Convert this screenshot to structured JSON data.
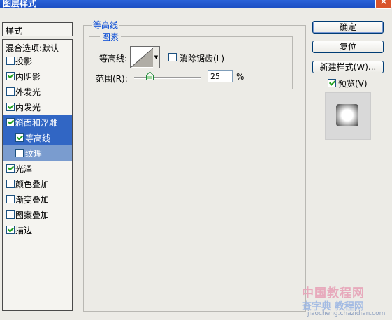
{
  "window": {
    "title": "图层样式"
  },
  "sidebar": {
    "header": "样式",
    "blend_options": "混合选项:默认",
    "items": [
      {
        "label": "投影",
        "checked": false
      },
      {
        "label": "内阴影",
        "checked": true
      },
      {
        "label": "外发光",
        "checked": false
      },
      {
        "label": "内发光",
        "checked": true
      },
      {
        "label": "斜面和浮雕",
        "checked": true,
        "selected": true
      },
      {
        "label": "等高线",
        "checked": true,
        "sub": true,
        "active": true
      },
      {
        "label": "纹理",
        "checked": false,
        "sub": true
      },
      {
        "label": "光泽",
        "checked": true
      },
      {
        "label": "颜色叠加",
        "checked": false
      },
      {
        "label": "渐变叠加",
        "checked": false
      },
      {
        "label": "图案叠加",
        "checked": false
      },
      {
        "label": "描边",
        "checked": true
      }
    ]
  },
  "panel": {
    "title": "等高线",
    "group": "图素",
    "contour_label": "等高线:",
    "anti_alias_label": "消除锯齿(L)",
    "anti_alias_checked": false,
    "range_label": "范围(R):",
    "range_value": "25",
    "range_unit": "%"
  },
  "buttons": {
    "ok": "确定",
    "reset": "复位",
    "new_style": "新建样式(W)..."
  },
  "preview": {
    "label": "预览(V)",
    "checked": true
  },
  "watermark": {
    "line1": "中国教程网",
    "line2": "查字典 教程网",
    "line3": "jiaocheng.chazidian.com"
  }
}
